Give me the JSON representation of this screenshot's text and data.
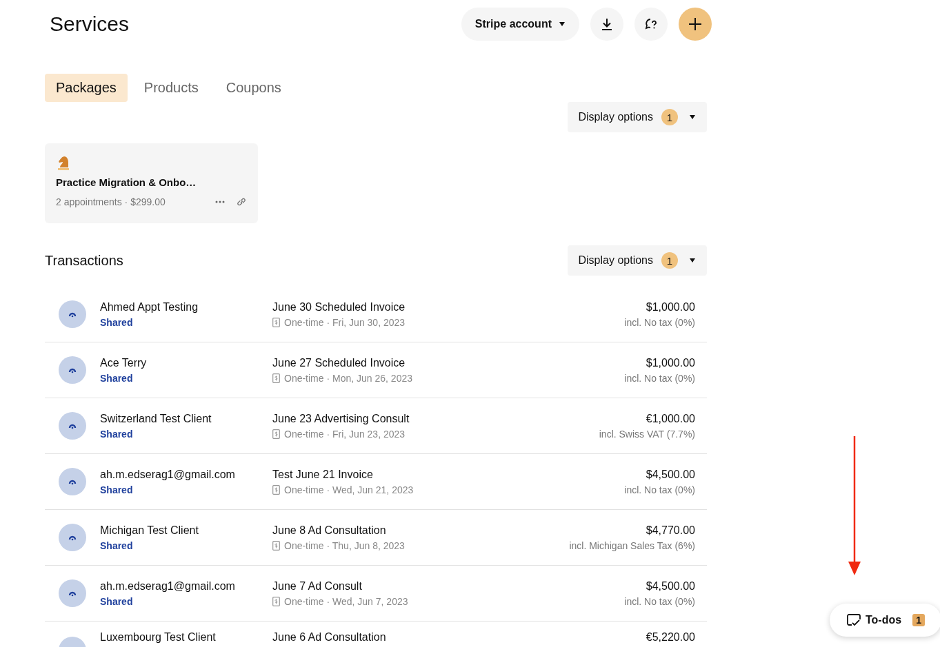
{
  "header": {
    "title": "Services",
    "account_button": "Stripe account"
  },
  "tabs": [
    {
      "label": "Packages",
      "selected": true
    },
    {
      "label": "Products",
      "selected": false
    },
    {
      "label": "Coupons",
      "selected": false
    }
  ],
  "packages_display_options": {
    "label": "Display options",
    "count": "1"
  },
  "packages": [
    {
      "title": "Practice Migration & Onbo…",
      "meta": "2 appointments · $299.00"
    }
  ],
  "transactions": {
    "title": "Transactions",
    "display_options": {
      "label": "Display options",
      "count": "1"
    },
    "rows": [
      {
        "client": "Ahmed Appt Testing",
        "status": "Shared",
        "title": "June 30 Scheduled Invoice",
        "meta": "One-time · Fri, Jun 30, 2023",
        "amount": "$1,000.00",
        "tax": "incl. No tax (0%)"
      },
      {
        "client": "Ace Terry",
        "status": "Shared",
        "title": "June 27 Scheduled Invoice",
        "meta": "One-time · Mon, Jun 26, 2023",
        "amount": "$1,000.00",
        "tax": "incl. No tax (0%)"
      },
      {
        "client": "Switzerland Test Client",
        "status": "Shared",
        "title": "June 23 Advertising Consult",
        "meta": "One-time · Fri, Jun 23, 2023",
        "amount": "€1,000.00",
        "tax": "incl. Swiss VAT (7.7%)"
      },
      {
        "client": "ah.m.edserag1@gmail.com",
        "status": "Shared",
        "title": "Test June 21 Invoice",
        "meta": "One-time · Wed, Jun 21, 2023",
        "amount": "$4,500.00",
        "tax": "incl. No tax (0%)"
      },
      {
        "client": "Michigan Test Client",
        "status": "Shared",
        "title": "June 8 Ad Consultation",
        "meta": "One-time · Thu, Jun 8, 2023",
        "amount": "$4,770.00",
        "tax": "incl. Michigan Sales Tax (6%)"
      },
      {
        "client": "ah.m.edserag1@gmail.com",
        "status": "Shared",
        "title": "June 7 Ad Consult",
        "meta": "One-time · Wed, Jun 7, 2023",
        "amount": "$4,500.00",
        "tax": "incl. No tax (0%)"
      },
      {
        "client": "Luxembourg Test Client",
        "title": "June 6 Ad Consultation",
        "amount": "€5,220.00"
      }
    ]
  },
  "todos": {
    "label": "To-dos",
    "count": "1"
  }
}
